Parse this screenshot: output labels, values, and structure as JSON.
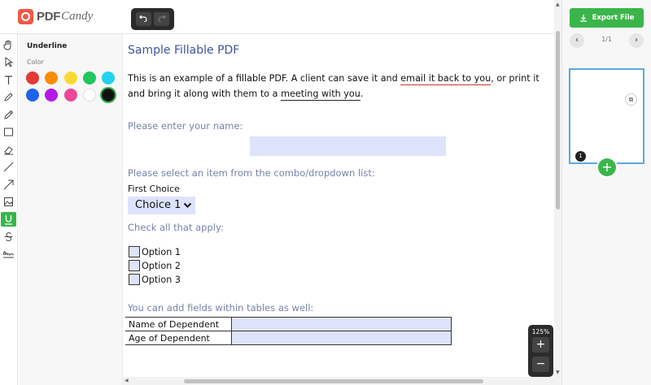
{
  "app": {
    "logo_pdf": "PDF",
    "logo_candy": "Candy"
  },
  "history": {
    "undo_icon": "undo-icon",
    "redo_icon": "redo-icon"
  },
  "toolbar": {
    "tools": [
      "hand",
      "select",
      "text",
      "pen",
      "pencil",
      "rectangle",
      "eraser",
      "line",
      "arrow",
      "image",
      "underline",
      "strikethrough",
      "signature"
    ],
    "active_tool": "underline"
  },
  "panel": {
    "title": "Underline",
    "color_label": "Color",
    "colors": [
      "#e53935",
      "#fb8c00",
      "#fdd835",
      "#22c55e",
      "#22d3ee",
      "#1e63e9",
      "#b21ce6",
      "#ec4899",
      "#ffffff",
      "#111111"
    ],
    "selected_color": "#111111"
  },
  "document": {
    "title": "Sample Fillable PDF",
    "intro_a": "This is an example of a fillable PDF. A client can save it and ",
    "intro_link1": "email it back to you",
    "intro_b": ", or print it and bring it along with them to a ",
    "intro_link2": "meeting with you",
    "intro_c": ".",
    "name_prompt": "Please enter your name:",
    "combo_prompt": "Please select an item from the combo/dropdown list:",
    "combo_caption": "First Choice",
    "combo_value": "Choice 1",
    "check_prompt": "Check all that apply:",
    "options": [
      "Option 1",
      "Option 2",
      "Option 3"
    ],
    "table_prompt": "You can add  fields within tables as well:",
    "table_rows": [
      "Name of Dependent",
      "Age of Dependent"
    ]
  },
  "zoom": {
    "level": "125%",
    "plus": "+",
    "minus": "−"
  },
  "right_panel": {
    "export_label": "Export File",
    "page_indicator": "1/1",
    "prev": "‹",
    "next": "›",
    "page_number": "1",
    "add": "+"
  },
  "colors": {
    "accent": "#3ab54a",
    "brand": "#ef5a46",
    "field_fill": "#dde3fb",
    "title_blue": "#3c5599"
  }
}
